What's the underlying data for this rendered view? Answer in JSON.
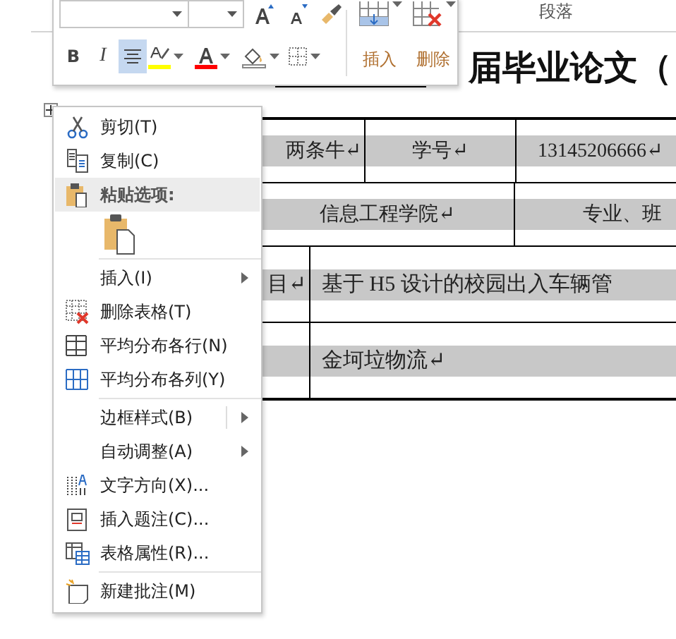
{
  "ribbon": {
    "group_label": "段落"
  },
  "mini_toolbar": {
    "format_buttons": [
      {
        "kind": "bold",
        "label": "B",
        "selected": false
      },
      {
        "kind": "italic",
        "label": "I",
        "selected": false
      },
      {
        "kind": "align",
        "selected": true
      },
      {
        "kind": "highlight",
        "color": "#ffff00"
      },
      {
        "kind": "font-color",
        "color": "#ff0000"
      },
      {
        "kind": "shading"
      },
      {
        "kind": "borders"
      }
    ],
    "table_buttons": [
      {
        "kind": "insert",
        "label": "插入"
      },
      {
        "kind": "delete",
        "label": "删除"
      }
    ]
  },
  "document": {
    "title": "届毕业论文（",
    "table": {
      "rows": [
        {
          "cells": [
            {
              "text": "两条牛↵"
            },
            {
              "text": "学号↵"
            },
            {
              "text": "13145206666↵"
            }
          ]
        },
        {
          "cells": [
            {
              "text": "信息工程学院↵"
            },
            {
              "text": "专业、班"
            }
          ]
        },
        {
          "cells": [
            {
              "text": "目↵"
            },
            {
              "text": "基于 H5 设计的校园出入车辆管"
            }
          ]
        },
        {
          "cells": [
            {},
            {
              "text": "金坷垃物流↵"
            }
          ]
        }
      ]
    }
  },
  "context_menu": {
    "groups": [
      {
        "items": [
          {
            "kind": "cut",
            "label": "剪切(T)",
            "highlighted": false,
            "submenu": false
          },
          {
            "kind": "copy",
            "label": "复制(C)",
            "highlighted": false,
            "submenu": false
          },
          {
            "kind": "paste-header",
            "label": "粘贴选项:",
            "highlighted": true,
            "submenu": false
          },
          {
            "kind": "paste-option",
            "highlighted": false,
            "submenu": false
          }
        ]
      },
      {
        "items": [
          {
            "kind": "plain",
            "label": "插入(I)",
            "highlighted": false,
            "submenu": true
          },
          {
            "kind": "delete-table",
            "label": "删除表格(T)",
            "highlighted": false,
            "submenu": false
          },
          {
            "kind": "distribute-rows",
            "label": "平均分布各行(N)",
            "highlighted": false,
            "submenu": false
          },
          {
            "kind": "distribute-cols",
            "label": "平均分布各列(Y)",
            "highlighted": false,
            "submenu": false
          }
        ]
      },
      {
        "items": [
          {
            "kind": "plain-split",
            "label": "边框样式(B)",
            "highlighted": false,
            "submenu": true
          },
          {
            "kind": "plain",
            "label": "自动调整(A)",
            "highlighted": false,
            "submenu": true
          },
          {
            "kind": "text-direction",
            "label": "文字方向(X)...",
            "highlighted": false,
            "submenu": false
          },
          {
            "kind": "caption",
            "label": "插入题注(C)...",
            "highlighted": false,
            "submenu": false
          },
          {
            "kind": "table-properties",
            "label": "表格属性(R)...",
            "highlighted": false,
            "submenu": false
          }
        ]
      },
      {
        "items": [
          {
            "kind": "new-comment",
            "label": "新建批注(M)",
            "highlighted": false,
            "submenu": false
          }
        ]
      }
    ]
  }
}
